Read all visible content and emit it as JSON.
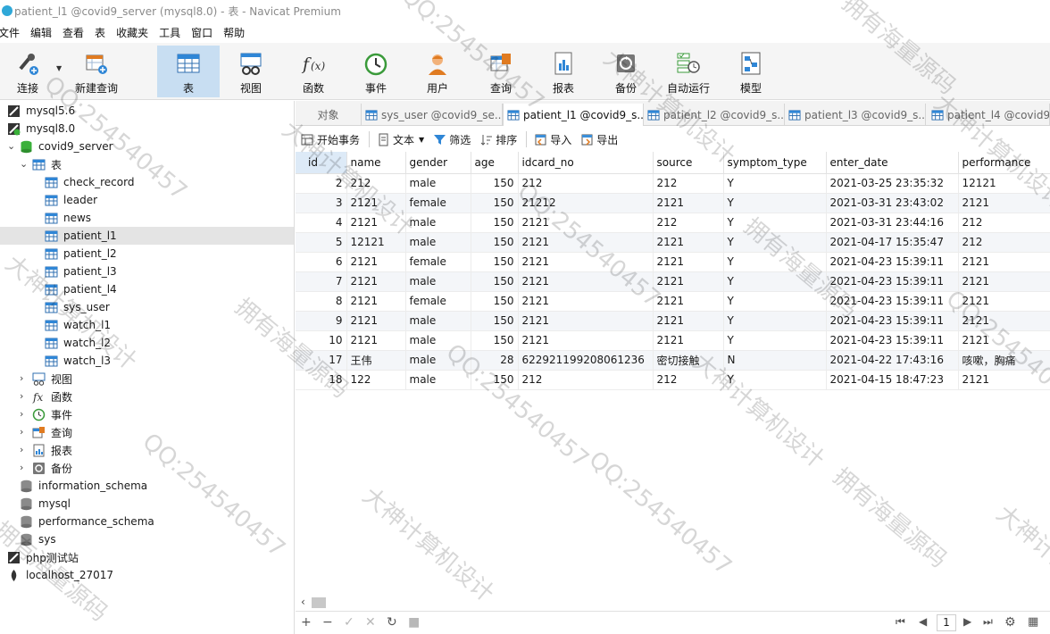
{
  "window": {
    "title": "patient_l1 @covid9_server (mysql8.0) - 表 - Navicat Premium"
  },
  "menu": [
    "文件",
    "编辑",
    "查看",
    "表",
    "收藏夹",
    "工具",
    "窗口",
    "帮助"
  ],
  "toolbar": [
    {
      "label": "连接",
      "icon": "connection-icon",
      "active": false
    },
    {
      "label": "新建查询",
      "icon": "new-query-icon",
      "active": false
    },
    {
      "label": "表",
      "icon": "table-icon",
      "active": true
    },
    {
      "label": "视图",
      "icon": "view-icon",
      "active": false
    },
    {
      "label": "函数",
      "icon": "function-icon",
      "active": false
    },
    {
      "label": "事件",
      "icon": "event-clock-icon",
      "active": false
    },
    {
      "label": "用户",
      "icon": "user-icon",
      "active": false
    },
    {
      "label": "查询",
      "icon": "query-icon",
      "active": false
    },
    {
      "label": "报表",
      "icon": "report-icon",
      "active": false
    },
    {
      "label": "备份",
      "icon": "backup-icon",
      "active": false
    },
    {
      "label": "自动运行",
      "icon": "automation-icon",
      "active": false
    },
    {
      "label": "模型",
      "icon": "model-icon",
      "active": false
    }
  ],
  "sidebar": {
    "connections": [
      "mysql5.6",
      "mysql8.0"
    ],
    "database": "covid9_server",
    "tables_folder": "表",
    "tables": [
      "check_record",
      "leader",
      "news",
      "patient_l1",
      "patient_l2",
      "patient_l3",
      "patient_l4",
      "sys_user",
      "watch_l1",
      "watch_l2",
      "watch_l3"
    ],
    "selected_table": "patient_l1",
    "folders": [
      "视图",
      "函数",
      "事件",
      "查询",
      "报表",
      "备份"
    ],
    "other_dbs": [
      "information_schema",
      "mysql",
      "performance_schema",
      "sys"
    ],
    "other_connections": [
      "php测试站",
      "localhost_27017"
    ]
  },
  "tabs": [
    {
      "label": "对象",
      "active": false
    },
    {
      "label": "sys_user @covid9_se...",
      "active": false
    },
    {
      "label": "patient_l1 @covid9_s...",
      "active": true
    },
    {
      "label": "patient_l2 @covid9_s...",
      "active": false
    },
    {
      "label": "patient_l3 @covid9_s...",
      "active": false
    },
    {
      "label": "patient_l4 @covid9_s",
      "active": false
    }
  ],
  "subtoolbar": {
    "begin_transaction": "开始事务",
    "text": "文本",
    "filter": "筛选",
    "sort": "排序",
    "import": "导入",
    "export": "导出"
  },
  "grid": {
    "columns": [
      "id",
      "name",
      "gender",
      "age",
      "idcard_no",
      "source",
      "symptom_type",
      "enter_date",
      "performance"
    ],
    "rows": [
      [
        "2",
        "212",
        "male",
        "150",
        "212",
        "212",
        "Y",
        "2021-03-25 23:35:32",
        "12121"
      ],
      [
        "3",
        "2121",
        "female",
        "150",
        "21212",
        "2121",
        "Y",
        "2021-03-31 23:43:02",
        "2121"
      ],
      [
        "4",
        "2121",
        "male",
        "150",
        "2121",
        "212",
        "Y",
        "2021-03-31 23:44:16",
        "212"
      ],
      [
        "5",
        "12121",
        "male",
        "150",
        "2121",
        "2121",
        "Y",
        "2021-04-17 15:35:47",
        "212"
      ],
      [
        "6",
        "2121",
        "female",
        "150",
        "2121",
        "2121",
        "Y",
        "2021-04-23 15:39:11",
        "2121"
      ],
      [
        "7",
        "2121",
        "male",
        "150",
        "2121",
        "2121",
        "Y",
        "2021-04-23 15:39:11",
        "2121"
      ],
      [
        "8",
        "2121",
        "female",
        "150",
        "2121",
        "2121",
        "Y",
        "2021-04-23 15:39:11",
        "2121"
      ],
      [
        "9",
        "2121",
        "male",
        "150",
        "2121",
        "2121",
        "Y",
        "2021-04-23 15:39:11",
        "2121"
      ],
      [
        "10",
        "2121",
        "male",
        "150",
        "2121",
        "2121",
        "Y",
        "2021-04-23 15:39:11",
        "2121"
      ],
      [
        "17",
        "王伟",
        "male",
        "28",
        "622921199208061236",
        "密切接触",
        "N",
        "2021-04-22 17:43:16",
        "咳嗽，胸痛"
      ],
      [
        "18",
        "122",
        "male",
        "150",
        "212",
        "212",
        "Y",
        "2021-04-15 18:47:23",
        "2121"
      ]
    ]
  },
  "pagination": {
    "page": "1"
  },
  "watermark": [
    "QQ:254540457",
    "大神计算机设计",
    "拥有海量源码"
  ]
}
